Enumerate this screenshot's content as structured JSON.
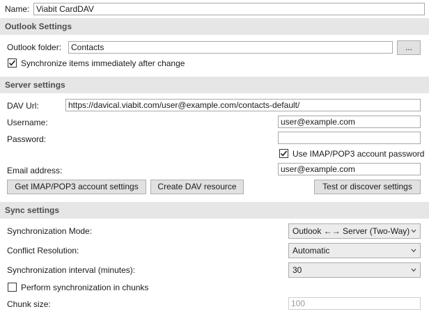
{
  "name": {
    "label": "Name:",
    "value": "Viabit CardDAV"
  },
  "outlook": {
    "header": "Outlook Settings",
    "folder_label": "Outlook folder:",
    "folder_value": "Contacts",
    "browse_label": "...",
    "sync_immediately_label": "Synchronize items immediately after change",
    "sync_immediately_checked": true
  },
  "server": {
    "header": "Server settings",
    "dav_url_label": "DAV Url:",
    "dav_url_value": "https://davical.viabit.com/user@example.com/contacts-default/",
    "username_label": "Username:",
    "username_value": "user@example.com",
    "password_label": "Password:",
    "password_value": "",
    "use_imap_password_label": "Use IMAP/POP3 account password",
    "use_imap_password_checked": true,
    "email_label": "Email address:",
    "email_value": "user@example.com",
    "get_imap_button": "Get IMAP/POP3 account settings",
    "create_dav_button": "Create DAV resource",
    "test_discover_button": "Test or discover settings"
  },
  "sync": {
    "header": "Sync settings",
    "mode_label": "Synchronization Mode:",
    "mode_value": "Outlook ←→ Server (Two-Way)",
    "conflict_label": "Conflict Resolution:",
    "conflict_value": "Automatic",
    "interval_label": "Synchronization interval (minutes):",
    "interval_value": "30",
    "chunks_label": "Perform synchronization in chunks",
    "chunks_checked": false,
    "chunk_size_label": "Chunk size:",
    "chunk_size_value": "100"
  },
  "icons": {
    "check": "checkmark-icon",
    "dropdown": "chevron-down-icon"
  }
}
